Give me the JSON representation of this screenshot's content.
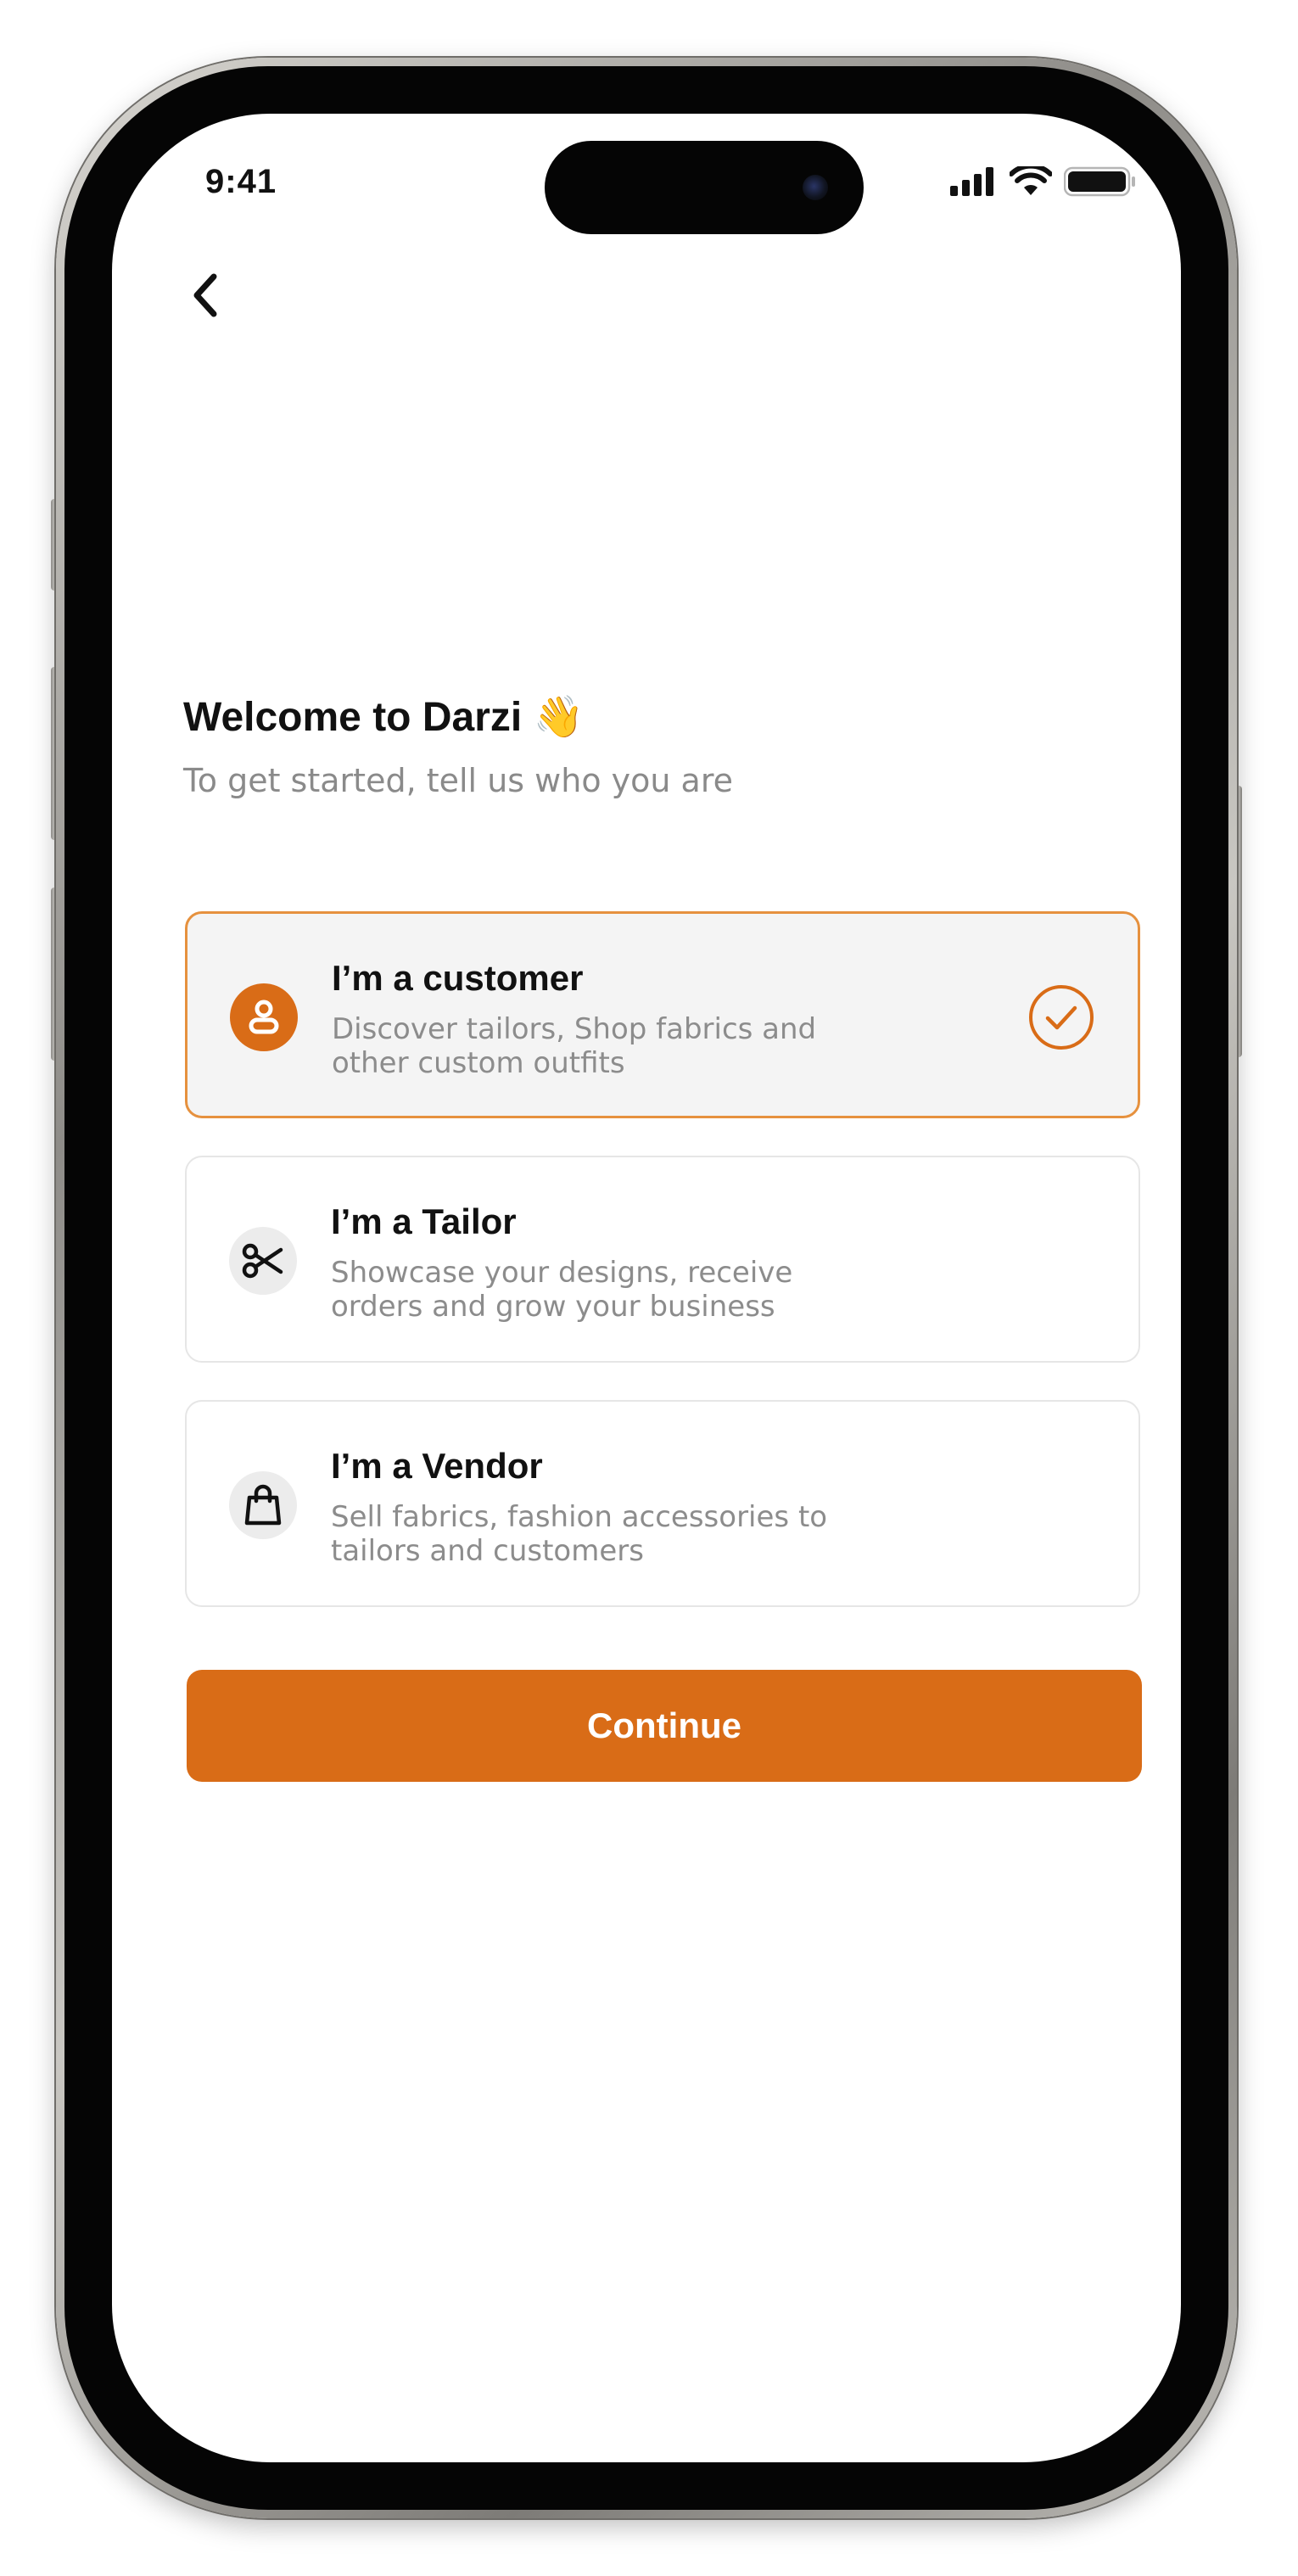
{
  "status_bar": {
    "time": "9:41",
    "icons": [
      "cellular-signal-icon",
      "wifi-icon",
      "battery-icon"
    ]
  },
  "nav": {
    "back_icon": "chevron-left-icon"
  },
  "header": {
    "title": "Welcome to Darzi 👋",
    "subtitle": "To get started, tell us who you are"
  },
  "roles": [
    {
      "title": "I’m a customer",
      "description": "Discover tailors, Shop fabrics and other custom outfits",
      "icon": "customer-icon",
      "selected": true
    },
    {
      "title": "I’m a Tailor",
      "description": "Showcase your designs, receive orders and grow your business",
      "icon": "scissors-icon",
      "selected": false
    },
    {
      "title": "I’m a Vendor",
      "description": "Sell fabrics, fashion accessories to tailors and customers",
      "icon": "shopping-bag-icon",
      "selected": false
    }
  ],
  "actions": {
    "continue_label": "Continue"
  },
  "colors": {
    "accent": "#D96C17",
    "selected_border": "#E6913E",
    "selected_background": "#F4F4F4",
    "text_primary": "#111111",
    "text_secondary": "#8C8C8C"
  }
}
